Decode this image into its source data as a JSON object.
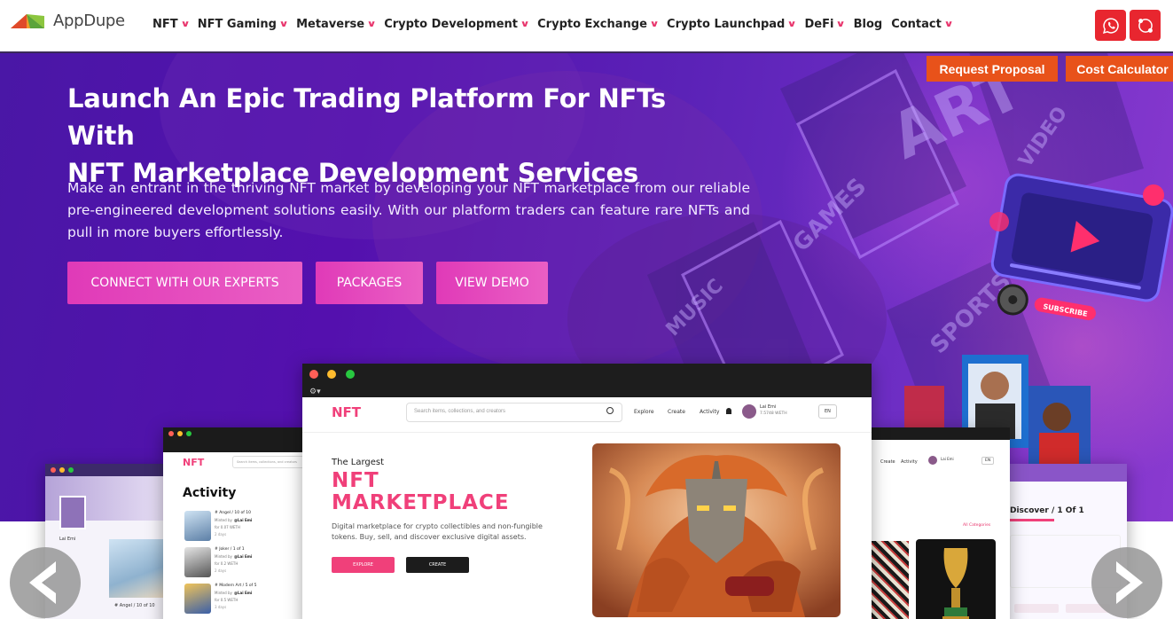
{
  "brand": {
    "name": "AppDupe"
  },
  "nav": {
    "items": [
      {
        "label": "NFT",
        "dropdown": true
      },
      {
        "label": "NFT Gaming",
        "dropdown": true
      },
      {
        "label": "Metaverse",
        "dropdown": true
      },
      {
        "label": "Crypto Development",
        "dropdown": true
      },
      {
        "label": "Crypto Exchange",
        "dropdown": true
      },
      {
        "label": "Crypto Launchpad",
        "dropdown": true
      },
      {
        "label": "DeFi",
        "dropdown": true
      },
      {
        "label": "Blog",
        "dropdown": false
      },
      {
        "label": "Contact",
        "dropdown": true
      }
    ],
    "social": [
      {
        "icon": "whatsapp-icon"
      },
      {
        "icon": "skype-icon"
      }
    ]
  },
  "hero": {
    "request_proposal": "Request Proposal",
    "cost_calculator": "Cost Calculator",
    "title_line1": "Launch An Epic Trading Platform For NFTs With",
    "title_line2": "NFT Marketplace Development Services",
    "description": "Make an entrant in the thriving NFT market by developing your NFT marketplace from our reliable pre-engineered development solutions easily. With our platform traders can feature rare NFTs and pull in more buyers effortlessly.",
    "buttons": [
      "CONNECT WITH OUR EXPERTS",
      "PACKAGES",
      "VIEW DEMO"
    ],
    "deco_words": [
      "ART",
      "GAMES",
      "VIDEO",
      "MUSIC",
      "SPORTS",
      "SUBSCRIBE"
    ]
  },
  "mockup": {
    "main": {
      "logo": "NFT",
      "search_placeholder": "Search items, collections, and creators",
      "menu": [
        "Explore",
        "Create",
        "Activity"
      ],
      "user_name": "Lai Emi",
      "user_balance": "7.5748 WETH",
      "lang": "EN",
      "headline_small": "The Largest",
      "headline_big1": "NFT",
      "headline_big2": "MARKETPLACE",
      "subtext": "Digital marketplace for crypto collectibles and non-fungible tokens. Buy, sell, and discover exclusive digital assets.",
      "explore_btn": "EXPLORE",
      "create_btn": "CREATE"
    },
    "left": {
      "logo": "NFT",
      "search_placeholder": "Search items, collections, and creators",
      "heading": "Activity",
      "items": [
        {
          "title": "# Angel / 10 of 10",
          "by": "Minted by",
          "user": "@Lai Emi",
          "price": "for 0.07 WETH",
          "time": "2 days"
        },
        {
          "title": "# Joker / 1 of 1",
          "by": "Minted by",
          "user": "@Lai Emi",
          "price": "for 0.2 WETH",
          "time": "2 days"
        },
        {
          "title": "# Modern Art / 5 of 5",
          "by": "Minted by",
          "user": "@Lai Emi",
          "price": "for 0.5 WETH",
          "time": "3 days"
        }
      ]
    },
    "far_left": {
      "caption": "# Angel / 10 of 10",
      "name": "Lai Emi"
    },
    "right": {
      "menu": [
        "Create",
        "Activity"
      ],
      "user_name": "Lai Emi",
      "lang": "EN",
      "filter": "All Categories"
    },
    "far_right": {
      "heading": "Discover / 1 Of 1"
    }
  },
  "carousel": {
    "prev": "previous-arrow",
    "next": "next-arrow"
  },
  "colors": {
    "accent_pink": "#f0407a",
    "button_pink": "#e03ab8",
    "orange": "#e8521a",
    "red": "#e8262f",
    "hero_purple": "#5410ae"
  }
}
